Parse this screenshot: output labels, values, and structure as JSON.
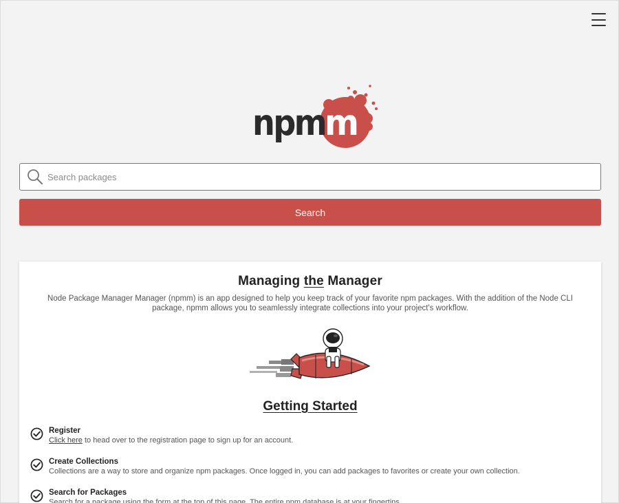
{
  "header": {
    "menu_icon": "hamburger-menu-icon"
  },
  "logo": {
    "text": "npmm",
    "colors": {
      "text": "#2b2b2b",
      "blob": "#c94f4a"
    }
  },
  "search": {
    "placeholder": "Search packages",
    "value": "",
    "icon": "search-icon",
    "button_label": "Search"
  },
  "colors": {
    "accent": "#c94f4a",
    "background": "#f3f3f3"
  },
  "card": {
    "title_prefix": "Managing ",
    "title_emphasis": "the",
    "title_suffix": " Manager",
    "intro": "Node Package Manager Manager (npmm) is an app designed to help you keep track of your favorite npm packages. With the addition of the Node CLI package, npmm allows you to seamlessly integrate collections into your project's workflow.",
    "illustration": "astronaut-on-rocket",
    "getting_started": "Getting Started",
    "steps": [
      {
        "icon": "check-circle-icon",
        "title": "Register",
        "link": "Click here",
        "desc": " to head over to the registration page to sign up for an account."
      },
      {
        "icon": "check-circle-icon",
        "title": "Create Collections",
        "desc": "Collections are a way to store and organize npm packages. Once logged in, you can add packages to favorites or create your own collection."
      },
      {
        "icon": "check-circle-icon",
        "title": "Search for Packages",
        "desc": "Search for a package using the form at the top of this page. The entire npm database is at your fingertips."
      }
    ]
  }
}
